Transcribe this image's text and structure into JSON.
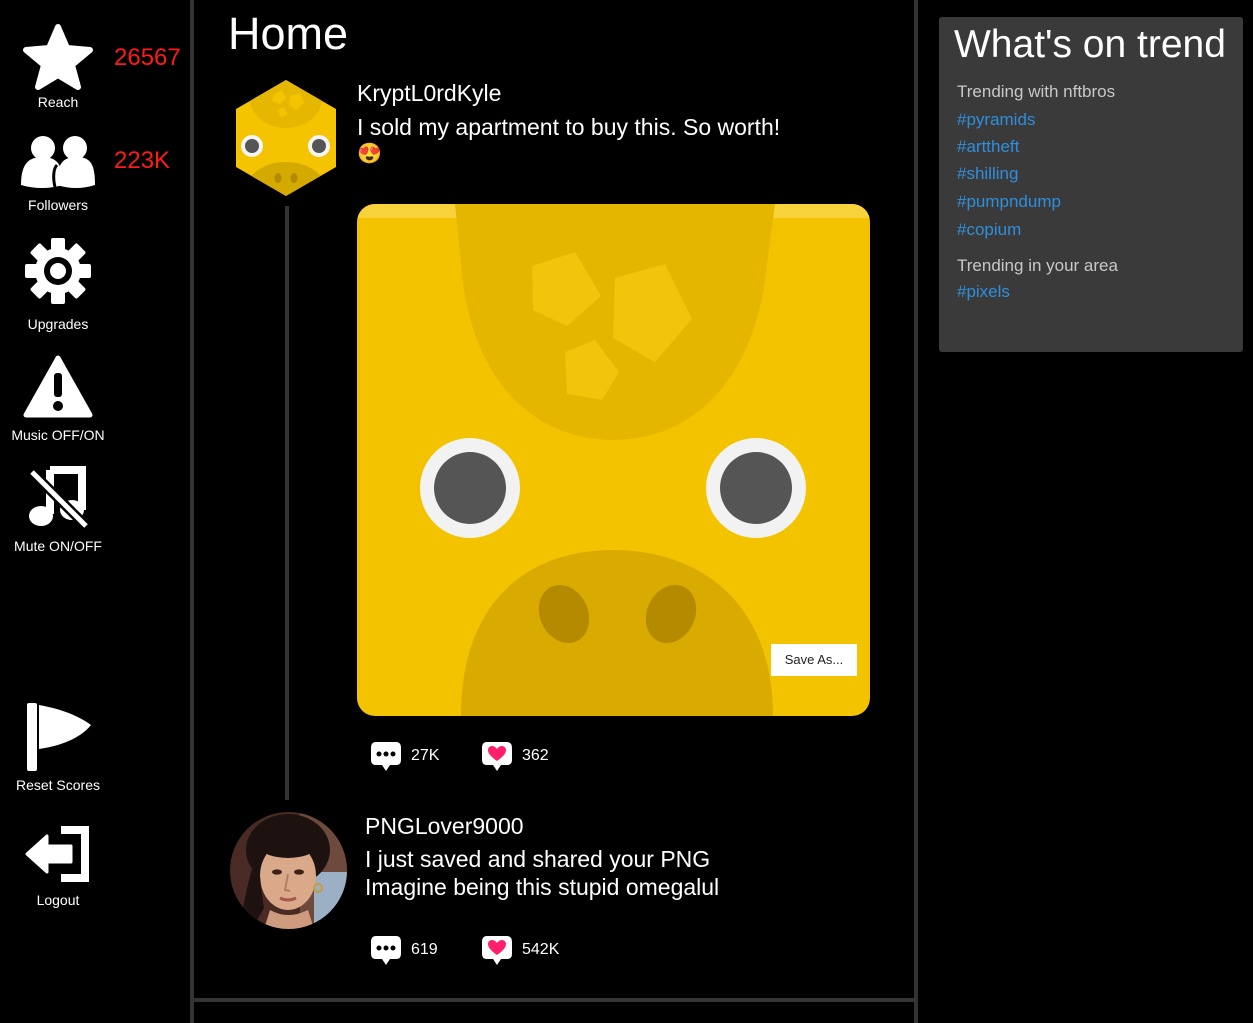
{
  "sidebar": {
    "reach": {
      "label": "Reach",
      "value": "26567"
    },
    "followers": {
      "label": "Followers",
      "value": "223K"
    },
    "upgrades": {
      "label": "Upgrades"
    },
    "music": {
      "label": "Music OFF/ON"
    },
    "mute": {
      "label": "Mute ON/OFF"
    },
    "reset": {
      "label": "Reset Scores"
    },
    "logout": {
      "label": "Logout"
    },
    "stat_color": "#ff1a1a"
  },
  "feed": {
    "title": "Home",
    "post": {
      "username": "KryptL0rdKyle",
      "text": "I sold my apartment to buy this. So worth!",
      "emoji": "😍",
      "save_label": "Save As...",
      "comments": "27K",
      "likes": "362"
    },
    "reply": {
      "username": "PNGLover9000",
      "line1": "I just saved and shared your PNG",
      "line2": "Imagine being this stupid omegalul",
      "comments": "619",
      "likes": "542K"
    }
  },
  "trends": {
    "title": "What's on trend",
    "section1": "Trending with nftbros",
    "tags1": [
      "#pyramids",
      "#arttheft",
      "#shilling",
      "#pumpndump",
      "#copium"
    ],
    "section2": "Trending in your area",
    "tags2": [
      "#pixels"
    ],
    "tag_color": "#2f8fdc"
  }
}
